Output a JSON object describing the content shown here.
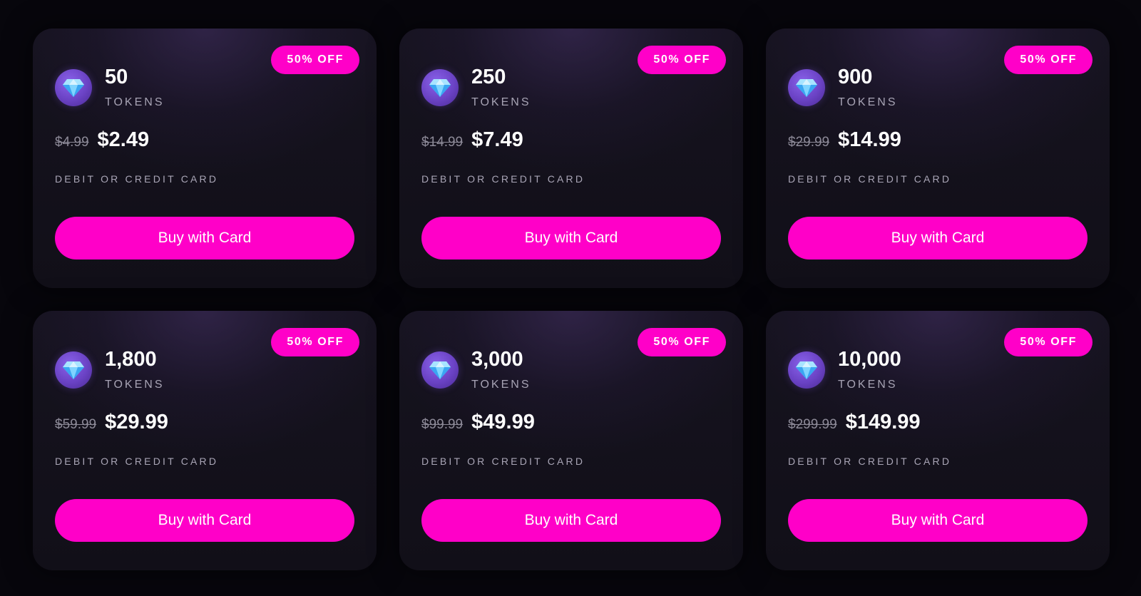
{
  "colors": {
    "accent": "#ff00c8",
    "background": "#07060c",
    "card": "#16131f",
    "gem": "#6a42c4"
  },
  "packs": [
    {
      "amount": "50",
      "unit": "TOKENS",
      "badge": "50% OFF",
      "old_price": "$4.99",
      "price": "$2.49",
      "method": "DEBIT OR CREDIT CARD",
      "button": "Buy with Card",
      "icon": "diamond-icon"
    },
    {
      "amount": "250",
      "unit": "TOKENS",
      "badge": "50% OFF",
      "old_price": "$14.99",
      "price": "$7.49",
      "method": "DEBIT OR CREDIT CARD",
      "button": "Buy with Card",
      "icon": "diamond-icon"
    },
    {
      "amount": "900",
      "unit": "TOKENS",
      "badge": "50% OFF",
      "old_price": "$29.99",
      "price": "$14.99",
      "method": "DEBIT OR CREDIT CARD",
      "button": "Buy with Card",
      "icon": "diamond-icon"
    },
    {
      "amount": "1,800",
      "unit": "TOKENS",
      "badge": "50% OFF",
      "old_price": "$59.99",
      "price": "$29.99",
      "method": "DEBIT OR CREDIT CARD",
      "button": "Buy with Card",
      "icon": "diamond-icon"
    },
    {
      "amount": "3,000",
      "unit": "TOKENS",
      "badge": "50% OFF",
      "old_price": "$99.99",
      "price": "$49.99",
      "method": "DEBIT OR CREDIT CARD",
      "button": "Buy with Card",
      "icon": "diamond-icon"
    },
    {
      "amount": "10,000",
      "unit": "TOKENS",
      "badge": "50% OFF",
      "old_price": "$299.99",
      "price": "$149.99",
      "method": "DEBIT OR CREDIT CARD",
      "button": "Buy with Card",
      "icon": "diamond-icon"
    }
  ]
}
